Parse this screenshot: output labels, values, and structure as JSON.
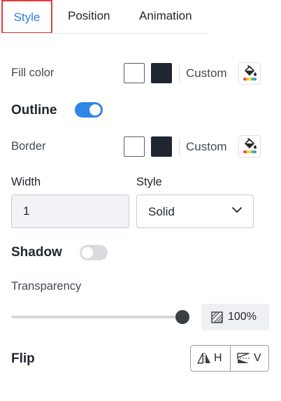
{
  "tabs": {
    "style": "Style",
    "position": "Position",
    "animation": "Animation",
    "active": "Style"
  },
  "fill": {
    "label": "Fill color",
    "swatches": [
      "#ffffff",
      "#1f2631"
    ],
    "custom_label": "Custom",
    "icon": "paint-bucket-icon"
  },
  "outline": {
    "label": "Outline",
    "enabled": true
  },
  "border": {
    "label": "Border",
    "swatches": [
      "#ffffff",
      "#1f2631"
    ],
    "custom_label": "Custom",
    "icon": "paint-bucket-icon"
  },
  "width": {
    "label": "Width",
    "value": "1"
  },
  "line_style": {
    "label": "Style",
    "selected": "Solid"
  },
  "shadow": {
    "label": "Shadow",
    "enabled": false
  },
  "transparency": {
    "label": "Transparency",
    "value_text": "100%",
    "value": 1.0
  },
  "flip": {
    "label": "Flip",
    "h_label": "H",
    "v_label": "V"
  },
  "colors": {
    "accent": "#2f86e8",
    "active_tab_border": "#e23b3b"
  }
}
